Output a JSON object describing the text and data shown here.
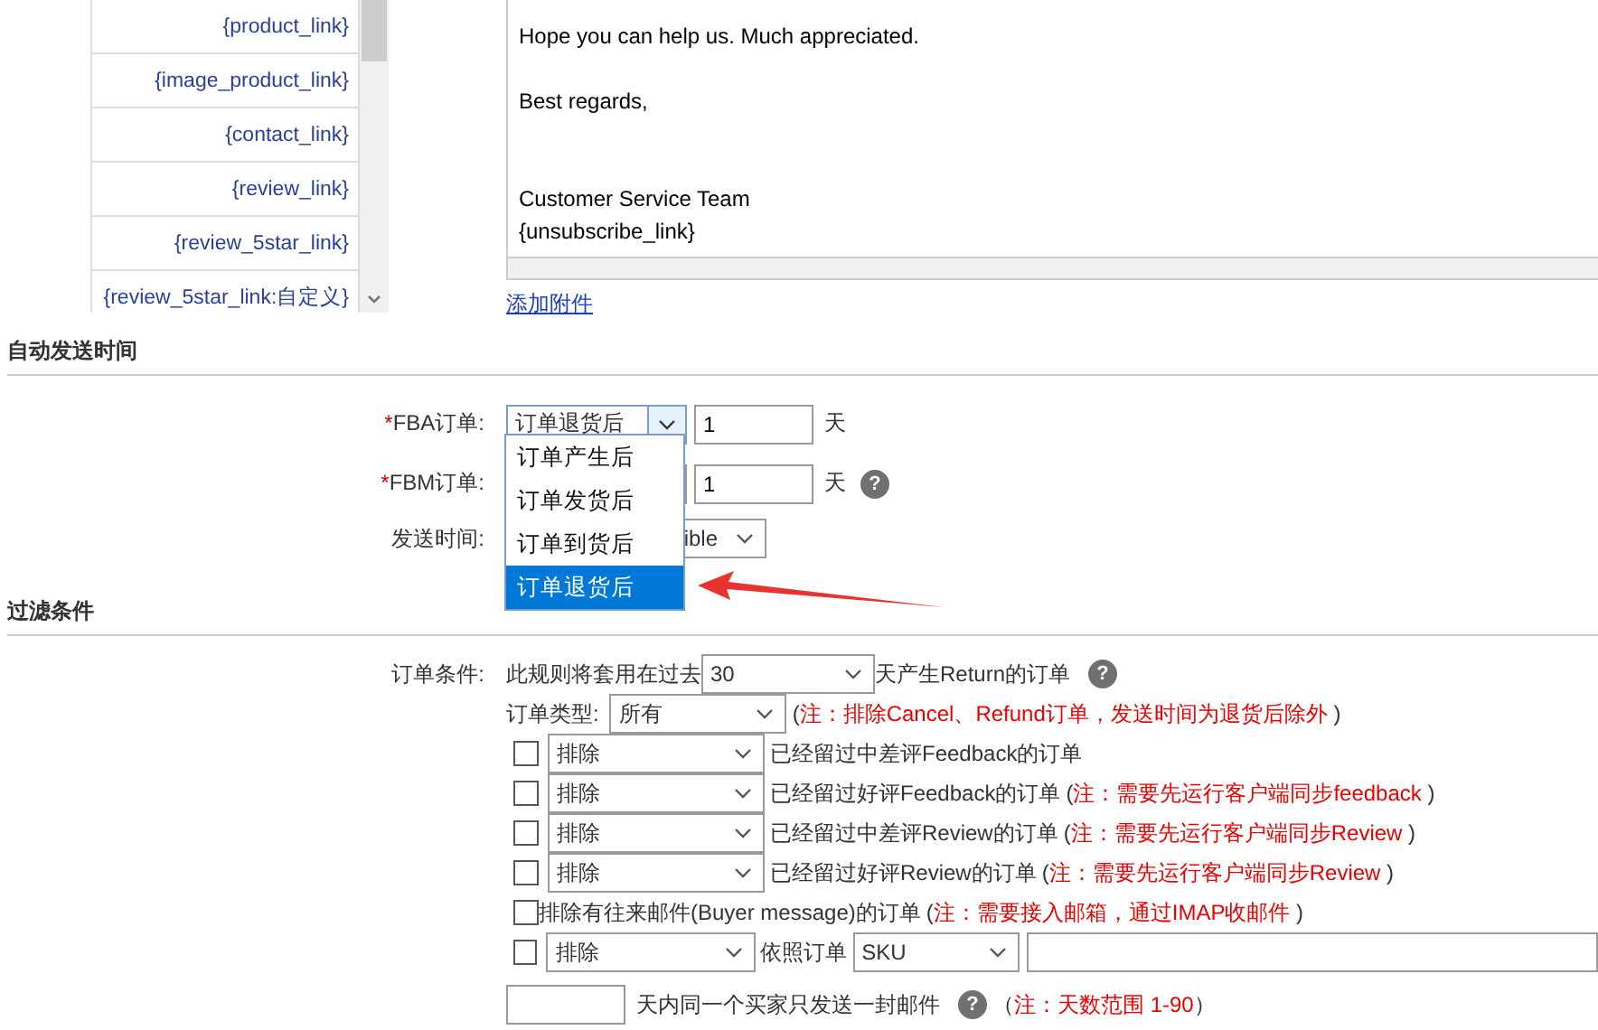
{
  "variables": [
    "{product_link}",
    "{image_product_link}",
    "{contact_link}",
    "{review_link}",
    "{review_5star_link}",
    "{review_5star_link:自定义}"
  ],
  "editor": {
    "paragraphs": [
      {
        "lines": [
          "Hope you can help us. Much appreciated."
        ]
      },
      {
        "lines": [
          "Best regards,"
        ]
      },
      {
        "lines": [
          "Customer Service Team",
          "{unsubscribe_link}"
        ]
      }
    ]
  },
  "attach_link": "添加附件",
  "send_time": {
    "title": "自动发送时间",
    "rows": [
      {
        "kind": "days",
        "mark": "*",
        "label": "FBA订单:",
        "select": "订单退货后",
        "days": "1",
        "unit": "天"
      },
      {
        "kind": "days",
        "mark": "*",
        "label": "FBM订单:",
        "days": "1",
        "unit": "天",
        "help": "?"
      },
      {
        "kind": "time",
        "label": "发送时间:",
        "select": "ible"
      }
    ]
  },
  "dropdown": {
    "options": [
      {
        "label": "订单产生后",
        "selected": false
      },
      {
        "label": "订单发货后",
        "selected": false
      },
      {
        "label": "订单到货后",
        "selected": false
      },
      {
        "label": "订单退货后",
        "selected": true
      }
    ]
  },
  "filter": {
    "title": "过滤条件",
    "condition": {
      "label": "订单条件:",
      "prefix": "此规则将套用在过去",
      "select": "30",
      "suffix": "天产生Return的订单",
      "help": "?"
    },
    "order_type": {
      "label": "订单类型:",
      "select": "所有",
      "note": {
        "open": "(",
        "text": "注：排除Cancel、Refund订单，发送时间为退货后除外",
        "close": ")"
      }
    },
    "rows": [
      {
        "kind": "select",
        "checked": false,
        "select": "排除",
        "text": "已经留过中差评Feedback的订单"
      },
      {
        "kind": "select",
        "checked": false,
        "select": "排除",
        "text": "已经留过好评Feedback的订单",
        "note": {
          "open": "(",
          "text": "注：需要先运行客户端同步feedback",
          "close": ")"
        }
      },
      {
        "kind": "select",
        "checked": false,
        "select": "排除",
        "text": "已经留过中差评Review的订单",
        "note": {
          "open": "(",
          "text": "注：需要先运行客户端同步Review",
          "close": ")"
        }
      },
      {
        "kind": "select",
        "checked": false,
        "select": "排除",
        "text": "已经留过好评Review的订单",
        "note": {
          "open": "(",
          "text": "注：需要先运行客户端同步Review",
          "close": ")"
        }
      },
      {
        "kind": "plain",
        "checked": false,
        "text": "排除有往来邮件(Buyer message)的订单",
        "note": {
          "open": "(",
          "text": "注：需要接入邮箱，通过IMAP收邮件",
          "close": ")"
        }
      },
      {
        "kind": "sku",
        "checked": false,
        "select": "排除",
        "text": "依照订单",
        "select2": "SKU"
      }
    ],
    "limit": {
      "text": "天内同一个买家只发送一封邮件",
      "help": "?",
      "note": {
        "open": "（",
        "text": "注：天数范围 1-90",
        "close": "）"
      }
    }
  }
}
